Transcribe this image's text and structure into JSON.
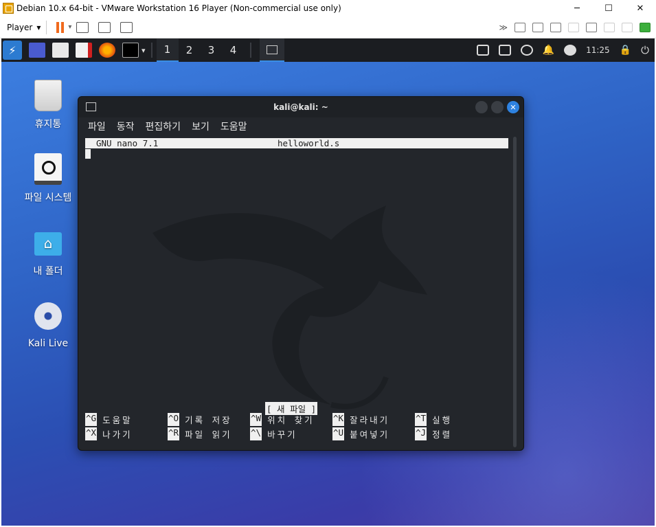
{
  "vm": {
    "title": "Debian 10.x 64-bit - VMware Workstation 16 Player (Non-commercial use only)",
    "player_label": "Player",
    "win_minimize": "─",
    "win_maximize": "☐",
    "win_close": "✕"
  },
  "panel": {
    "workspaces": [
      "1",
      "2",
      "3",
      "4"
    ],
    "clock": "11:25"
  },
  "desktop": {
    "icons": [
      {
        "label": "휴지통"
      },
      {
        "label": "파일 시스템"
      },
      {
        "label": "내 폴더"
      },
      {
        "label": "Kali Live"
      }
    ]
  },
  "terminal": {
    "title": "kali@kali: ~",
    "menu": [
      "파일",
      "동작",
      "편집하기",
      "보기",
      "도움말"
    ],
    "close_glyph": "✕"
  },
  "nano": {
    "version": "GNU nano 7.1",
    "filename": "helloworld.s",
    "status": "[ 새 파일 ]",
    "shortcuts": [
      {
        "key": "^G",
        "label": "도움말"
      },
      {
        "key": "^O",
        "label": "기록 저장"
      },
      {
        "key": "^W",
        "label": "위치 찾기"
      },
      {
        "key": "^K",
        "label": "잘라내기"
      },
      {
        "key": "^T",
        "label": "실행"
      },
      {
        "key": "^X",
        "label": "나가기"
      },
      {
        "key": "^R",
        "label": "파일 읽기"
      },
      {
        "key": "^\\",
        "label": "바꾸기"
      },
      {
        "key": "^U",
        "label": "붙여넣기"
      },
      {
        "key": "^J",
        "label": "정렬"
      }
    ]
  }
}
